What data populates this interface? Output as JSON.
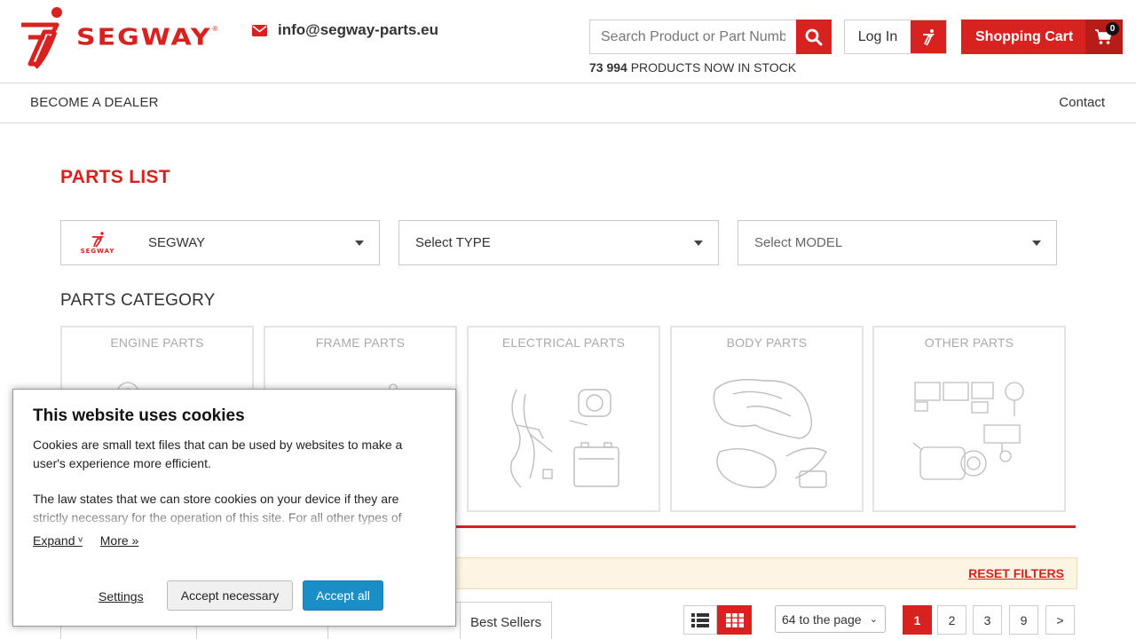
{
  "header": {
    "brand_name": "SEGWAY",
    "email": "info@segway-parts.eu",
    "search_placeholder": "Search Product or Part Number",
    "stock_count": "73 994",
    "stock_text": "PRODUCTS NOW IN STOCK",
    "login_label": "Log In",
    "cart_label": "Shopping Cart",
    "cart_count": "0"
  },
  "nav": {
    "dealer": "BECOME A DEALER",
    "contact": "Contact"
  },
  "main": {
    "title": "PARTS LIST",
    "brand_select": "SEGWAY",
    "brand_logo_text": "SEGWAY",
    "type_select": "Select TYPE",
    "model_select": "Select MODEL",
    "category_title": "PARTS CATEGORY",
    "categories": [
      {
        "label": "ENGINE PARTS"
      },
      {
        "label": "FRAME PARTS"
      },
      {
        "label": "ELECTRICAL PARTS"
      },
      {
        "label": "BODY PARTS"
      },
      {
        "label": "OTHER PARTS"
      }
    ],
    "reset_filters": "RESET FILTERS",
    "sort_tabs": [
      "",
      "",
      "",
      "Best Sellers"
    ],
    "per_page": "64 to the page",
    "pages": [
      "1",
      "2",
      "3",
      "9",
      ">"
    ]
  },
  "cookie": {
    "title": "This website uses cookies",
    "p1": "Cookies are small text files that can be used by websites to make a user's experience more efficient.",
    "p2": "The law states that we can store cookies on your device if they are strictly necessary for the operation of this site. For all other types of",
    "expand": "Expand ᵛ",
    "more": "More »",
    "settings": "Settings",
    "accept_necessary": "Accept necessary",
    "accept_all": "Accept all"
  },
  "colors": {
    "brand_red": "#d7221f",
    "accept_blue": "#1a8ec6",
    "filter_bg": "#fdf4e4"
  }
}
